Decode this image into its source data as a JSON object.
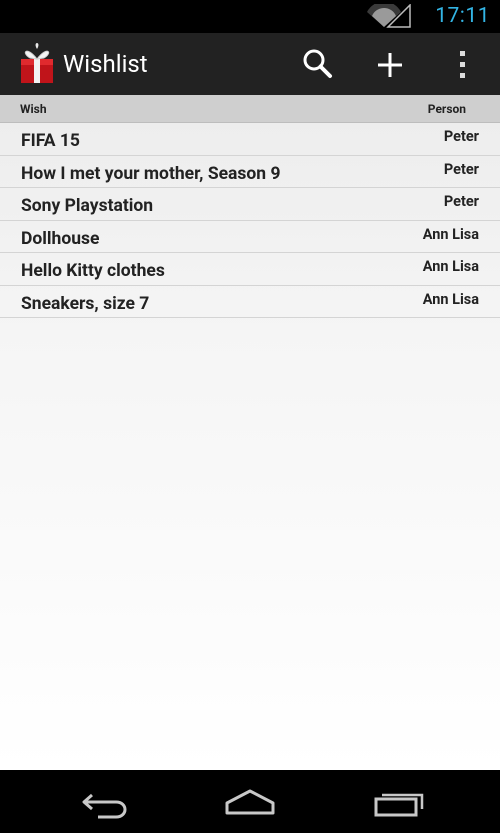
{
  "status_bar": {
    "time": "17:11",
    "icons": [
      "wifi-icon",
      "signal-icon"
    ],
    "accent_color": "#33b5e5"
  },
  "action_bar": {
    "title": "Wishlist",
    "app_icon": "gift-icon",
    "actions": [
      "search-icon",
      "add-icon",
      "overflow-menu-icon"
    ]
  },
  "table": {
    "header": {
      "wish": "Wish",
      "person": "Person"
    },
    "rows": [
      {
        "wish": "FIFA 15",
        "person": "Peter"
      },
      {
        "wish": "How I met your mother, Season 9",
        "person": "Peter"
      },
      {
        "wish": "Sony Playstation",
        "person": "Peter"
      },
      {
        "wish": "Dollhouse",
        "person": "Ann Lisa"
      },
      {
        "wish": "Hello Kitty clothes",
        "person": "Ann Lisa"
      },
      {
        "wish": "Sneakers, size 7",
        "person": "Ann Lisa"
      }
    ]
  },
  "nav_bar": {
    "buttons": [
      "back-icon",
      "home-icon",
      "recent-apps-icon"
    ]
  }
}
